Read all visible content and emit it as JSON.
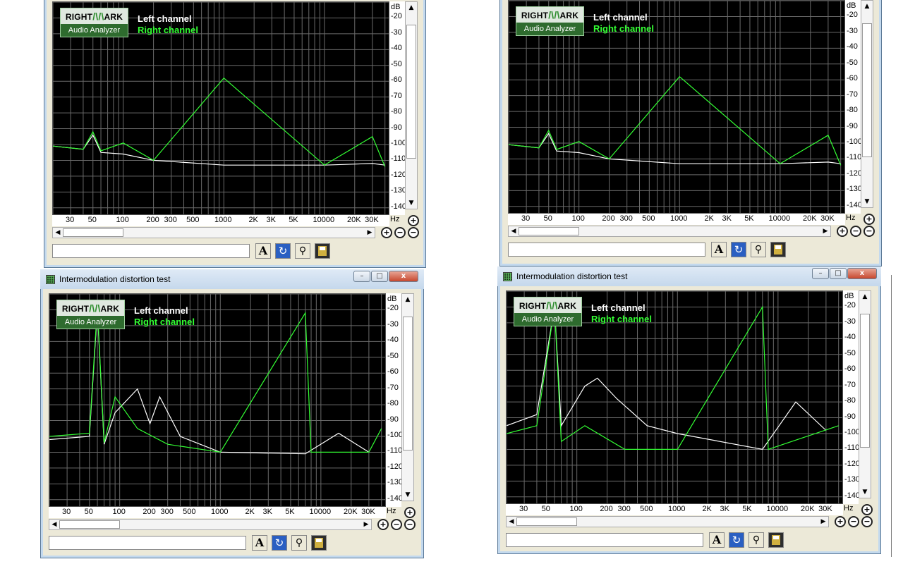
{
  "windows": [
    {
      "id": "top-left",
      "has_title": false,
      "title": "",
      "legend": {
        "left": "Left channel",
        "right": "Right channel"
      },
      "variant": "thd"
    },
    {
      "id": "top-right",
      "has_title": false,
      "title": "",
      "legend": {
        "left": "Left channel",
        "right": "Right channel"
      },
      "variant": "thd"
    },
    {
      "id": "bottom-left",
      "has_title": true,
      "title": "Intermodulation distortion test",
      "legend": {
        "left": "Left channel",
        "right": "Right channel"
      },
      "variant": "imd"
    },
    {
      "id": "bottom-right",
      "has_title": true,
      "title": "Intermodulation distortion test",
      "legend": {
        "left": "Left channel",
        "right": "Right channel"
      },
      "variant": "imd2"
    }
  ],
  "logo": {
    "line1_a": "RIGHT",
    "line1_m": "/\\/\\",
    "line1_b": "ARK",
    "line2": "Audio Analyzer"
  },
  "axis": {
    "y_unit": "dB",
    "y_ticks": [
      "-20",
      "-30",
      "-40",
      "-50",
      "-60",
      "-70",
      "-80",
      "-90",
      "-100",
      "-110",
      "-120",
      "-130",
      "-140"
    ],
    "x_unit": "Hz",
    "x_ticks": [
      "30",
      "50",
      "100",
      "200",
      "300",
      "500",
      "1000",
      "2K",
      "3K",
      "5K",
      "10000",
      "20K",
      "30K"
    ]
  },
  "toolbar": {
    "text_button": "A"
  },
  "window_buttons": {
    "min": "–",
    "max": "□",
    "close": "x"
  },
  "icons": [
    "zoom-in-icon",
    "zoom-out-icon",
    "text-icon",
    "refresh-icon",
    "probe-icon",
    "save-icon",
    "scroll-up-icon",
    "scroll-down-icon",
    "scroll-left-icon",
    "scroll-right-icon"
  ],
  "chart_data": [
    {
      "type": "line",
      "xlabel": "Hz",
      "ylabel": "dB",
      "x_scale": "log",
      "xlim": [
        20,
        45000
      ],
      "ylim": [
        -145,
        -10
      ],
      "series": [
        {
          "name": "Left channel",
          "color": "#ffffff",
          "points": [
            [
              20,
              -101
            ],
            [
              40,
              -103
            ],
            [
              50,
              -94
            ],
            [
              60,
              -105
            ],
            [
              100,
              -106
            ],
            [
              200,
              -110
            ],
            [
              1000,
              -113
            ],
            [
              10000,
              -113
            ],
            [
              30000,
              -112
            ],
            [
              40000,
              -113
            ]
          ]
        },
        {
          "name": "Right channel",
          "color": "#33ff33",
          "points": [
            [
              20,
              -101
            ],
            [
              40,
              -103
            ],
            [
              50,
              -92
            ],
            [
              60,
              -104
            ],
            [
              100,
              -99
            ],
            [
              200,
              -110
            ],
            [
              1000,
              -58
            ],
            [
              10000,
              -113
            ],
            [
              25000,
              -98
            ],
            [
              30000,
              -95
            ],
            [
              40000,
              -114
            ]
          ]
        }
      ]
    },
    {
      "type": "line",
      "xlabel": "Hz",
      "ylabel": "dB",
      "x_scale": "log",
      "xlim": [
        20,
        45000
      ],
      "ylim": [
        -145,
        -10
      ],
      "series": [
        {
          "name": "Left channel",
          "color": "#ffffff",
          "points": [
            [
              20,
              -101
            ],
            [
              40,
              -103
            ],
            [
              50,
              -94
            ],
            [
              60,
              -105
            ],
            [
              100,
              -106
            ],
            [
              200,
              -110
            ],
            [
              1000,
              -113
            ],
            [
              10000,
              -113
            ],
            [
              30000,
              -112
            ],
            [
              40000,
              -113
            ]
          ]
        },
        {
          "name": "Right channel",
          "color": "#33ff33",
          "points": [
            [
              20,
              -101
            ],
            [
              40,
              -103
            ],
            [
              50,
              -92
            ],
            [
              60,
              -104
            ],
            [
              100,
              -99
            ],
            [
              200,
              -110
            ],
            [
              1000,
              -58
            ],
            [
              10000,
              -113
            ],
            [
              25000,
              -98
            ],
            [
              30000,
              -95
            ],
            [
              40000,
              -114
            ]
          ]
        }
      ]
    },
    {
      "type": "line",
      "xlabel": "Hz",
      "ylabel": "dB",
      "x_scale": "log",
      "xlim": [
        20,
        45000
      ],
      "ylim": [
        -145,
        -10
      ],
      "series": [
        {
          "name": "Left channel",
          "color": "#ffffff",
          "points": [
            [
              20,
              -102
            ],
            [
              50,
              -100
            ],
            [
              60,
              -20
            ],
            [
              70,
              -105
            ],
            [
              90,
              -85
            ],
            [
              150,
              -70
            ],
            [
              200,
              -92
            ],
            [
              250,
              -75
            ],
            [
              400,
              -100
            ],
            [
              1000,
              -110
            ],
            [
              7000,
              -111
            ],
            [
              15000,
              -98
            ],
            [
              30000,
              -110
            ]
          ]
        },
        {
          "name": "Right channel",
          "color": "#33ff33",
          "points": [
            [
              20,
              -100
            ],
            [
              50,
              -98
            ],
            [
              60,
              -18
            ],
            [
              70,
              -104
            ],
            [
              90,
              -75
            ],
            [
              150,
              -95
            ],
            [
              300,
              -105
            ],
            [
              1000,
              -110
            ],
            [
              7000,
              -22
            ],
            [
              8000,
              -110
            ],
            [
              30000,
              -110
            ],
            [
              40000,
              -95
            ]
          ]
        }
      ]
    },
    {
      "type": "line",
      "xlabel": "Hz",
      "ylabel": "dB",
      "x_scale": "log",
      "xlim": [
        20,
        45000
      ],
      "ylim": [
        -145,
        -10
      ],
      "series": [
        {
          "name": "Left channel",
          "color": "#ffffff",
          "points": [
            [
              20,
              -95
            ],
            [
              40,
              -88
            ],
            [
              60,
              -20
            ],
            [
              70,
              -95
            ],
            [
              120,
              -70
            ],
            [
              160,
              -65
            ],
            [
              250,
              -78
            ],
            [
              500,
              -95
            ],
            [
              1000,
              -100
            ],
            [
              7000,
              -110
            ],
            [
              15000,
              -80
            ],
            [
              30000,
              -98
            ]
          ]
        },
        {
          "name": "Right channel",
          "color": "#33ff33",
          "points": [
            [
              20,
              -100
            ],
            [
              40,
              -95
            ],
            [
              60,
              -20
            ],
            [
              70,
              -105
            ],
            [
              120,
              -95
            ],
            [
              300,
              -110
            ],
            [
              1000,
              -110
            ],
            [
              7000,
              -20
            ],
            [
              8000,
              -110
            ],
            [
              40000,
              -95
            ]
          ]
        }
      ]
    }
  ]
}
